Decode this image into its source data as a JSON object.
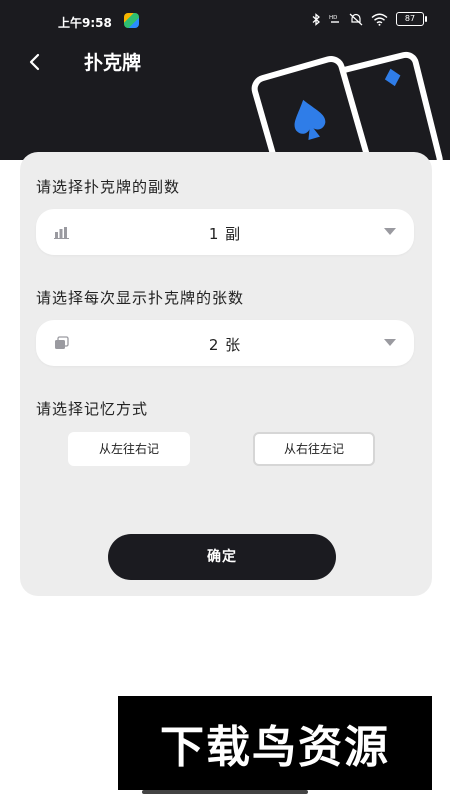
{
  "status_bar": {
    "time": "上午9:58",
    "app_icon": "colorful-app-icon",
    "icons": [
      "bluetooth-icon",
      "hd-icon",
      "silent-icon",
      "wifi-icon"
    ],
    "battery": "87"
  },
  "nav": {
    "back_icon": "chevron-left-icon",
    "title": "扑克牌"
  },
  "illustration": "playing-cards-icon",
  "form": {
    "decks": {
      "label": "请选择扑克牌的副数",
      "icon": "bar-chart-icon",
      "value": "1 副"
    },
    "per_show": {
      "label": "请选择每次显示扑克牌的张数",
      "icon": "cards-stack-icon",
      "value": "2 张"
    },
    "order": {
      "label": "请选择记忆方式",
      "options": [
        "从左往右记",
        "从右往左记"
      ],
      "selected_index": 1
    },
    "confirm_label": "确定"
  },
  "watermark": {
    "text": "下载鸟资源"
  },
  "colors": {
    "header_bg": "#1b1b1f",
    "panel_bg": "#ededed",
    "accent_blue": "#2f7de8",
    "button_dark": "#1b1b20"
  }
}
